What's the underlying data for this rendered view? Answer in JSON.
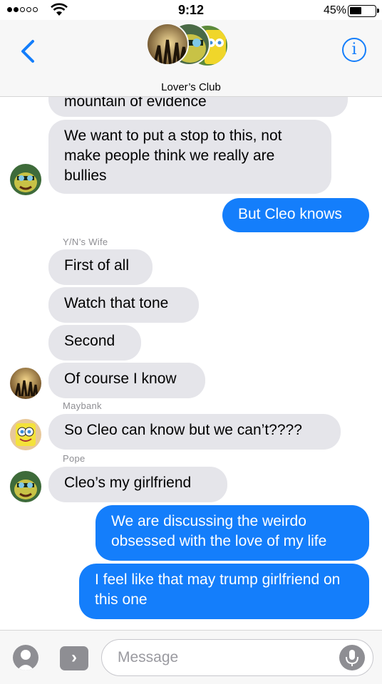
{
  "status_bar": {
    "time": "9:12",
    "battery": "45%",
    "signal_bars_filled": 2,
    "signal_bars_total": 5
  },
  "header": {
    "group_name": "Lover’s Club",
    "back_icon": "chevron-left-icon",
    "info_icon": "info-icon",
    "info_label": "i"
  },
  "colors": {
    "accent": "#147efb",
    "incoming_bubble": "#e5e5ea",
    "outgoing_bubble": "#147efb",
    "header_bg": "#f7f7f7"
  },
  "messages": [
    {
      "direction": "in",
      "sender": "",
      "text": "mountain of evidence",
      "partial": true
    },
    {
      "direction": "in",
      "sender": "",
      "text": "We want to put a stop to this, not make people think we really are bullies"
    },
    {
      "direction": "out",
      "text": "But Cleo knows"
    },
    {
      "direction": "in",
      "sender": "Y/N’s Wife",
      "text": "First of all"
    },
    {
      "direction": "in",
      "text": "Watch that tone"
    },
    {
      "direction": "in",
      "text": "Second"
    },
    {
      "direction": "in",
      "text": "Of course I know"
    },
    {
      "direction": "in",
      "sender": "Maybank",
      "text": "So Cleo can know but we can’t????"
    },
    {
      "direction": "in",
      "sender": "Pope",
      "text": "Cleo’s my girlfriend"
    },
    {
      "direction": "out",
      "text": "We are discussing the weirdo obsessed with the love of my life"
    },
    {
      "direction": "out",
      "text": "I feel like that may trump girlfriend on this one"
    }
  ],
  "input_bar": {
    "placeholder": "Message",
    "camera_icon": "camera-icon",
    "apps_icon": "chevron-right-icon",
    "apps_label": "›",
    "mic_icon": "microphone-icon"
  }
}
